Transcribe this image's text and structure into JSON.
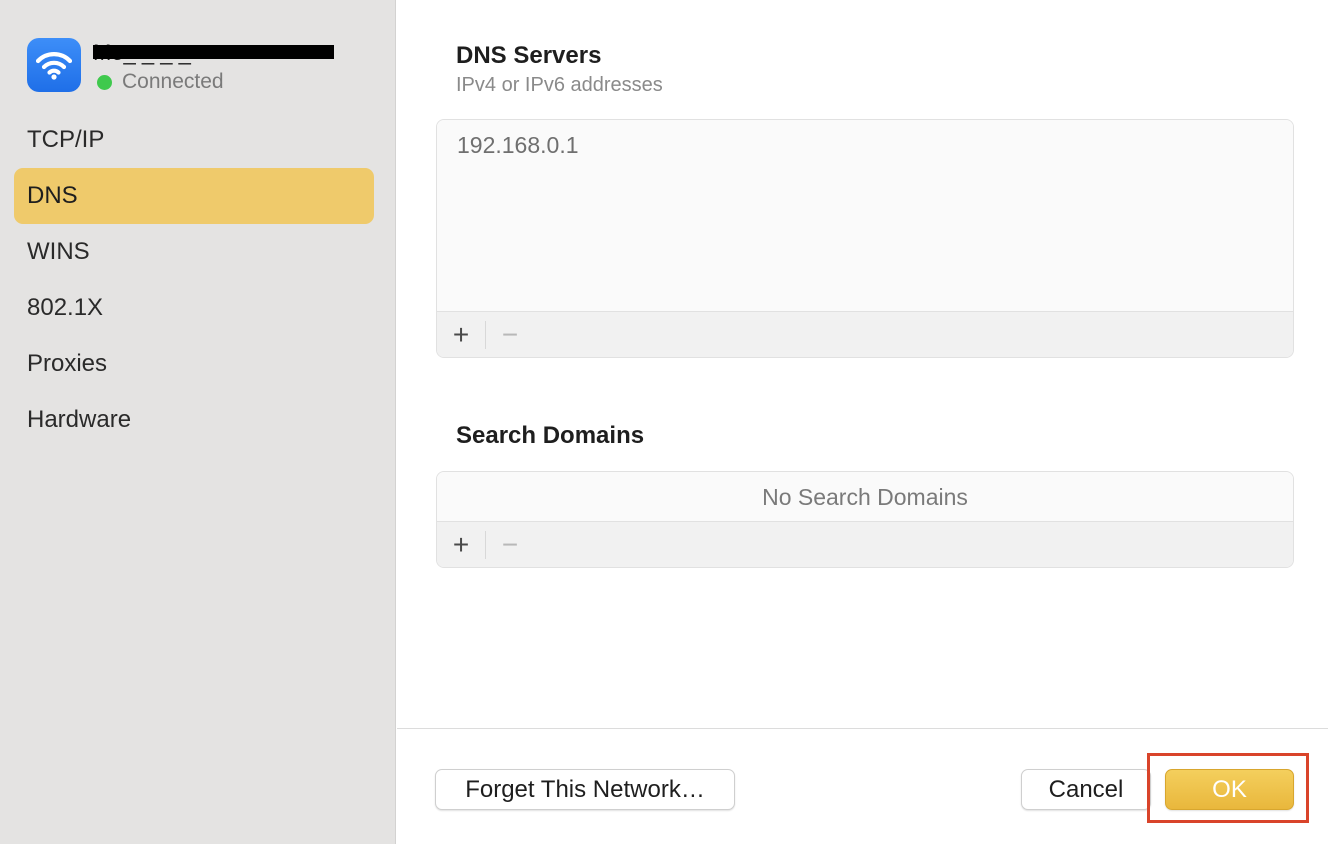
{
  "network": {
    "name": "Mo_ _ _ _",
    "status": "Connected",
    "status_color": "#3fc94d",
    "icon": "wifi-icon"
  },
  "sidebar": {
    "items": [
      {
        "label": "TCP/IP",
        "active": false
      },
      {
        "label": "DNS",
        "active": true
      },
      {
        "label": "WINS",
        "active": false
      },
      {
        "label": "802.1X",
        "active": false
      },
      {
        "label": "Proxies",
        "active": false
      },
      {
        "label": "Hardware",
        "active": false
      }
    ]
  },
  "dns_servers": {
    "title": "DNS Servers",
    "subtitle": "IPv4 or IPv6 addresses",
    "entries": [
      "192.168.0.1"
    ],
    "add_label": "+",
    "remove_label": "−"
  },
  "search_domains": {
    "title": "Search Domains",
    "empty_text": "No Search Domains",
    "add_label": "+",
    "remove_label": "−"
  },
  "footer": {
    "forget_label": "Forget This Network…",
    "cancel_label": "Cancel",
    "ok_label": "OK"
  },
  "colors": {
    "accent": "#efca6b",
    "primary_button": "#e9b73c",
    "highlight": "#d9442a"
  }
}
